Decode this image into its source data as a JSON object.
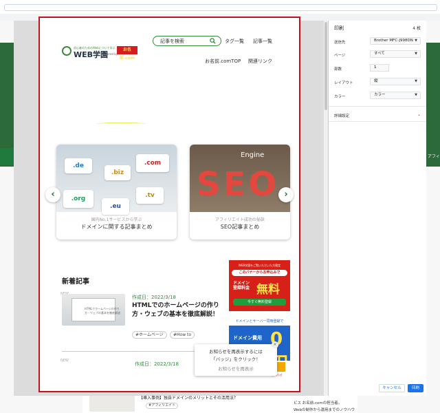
{
  "page": {
    "header": {
      "logo_text": "WEB学園",
      "logo_small": "初心者のためのWebについて学ぶ",
      "logo_powered": "Powered by",
      "logo_badge": "お名前.com"
    },
    "search_placeholder": "記事を検索",
    "nav": [
      "タグ一覧",
      "記事一覧",
      "お名前.comTOP",
      "関連リンク"
    ],
    "carousel": [
      {
        "sub": "国内No.1サービスから学ぶ",
        "title": "ドメインに関する記事まとめ",
        "bubbles": [
          ".de",
          ".biz",
          ".com",
          ".org",
          ".eu",
          ".tv"
        ]
      },
      {
        "sub": "アフィリエイト成功の秘訣",
        "title": "SEO記事まとめ",
        "image_text": "SEO",
        "image_word": "Engine"
      }
    ],
    "carousel_prev": "‹",
    "carousel_next": "›",
    "section_title": "新着記事",
    "articles": [
      {
        "badge": "NEW",
        "date": "作成日：2022/3/18",
        "title": "HTMLでのホームページの作り方・ウェブの基本を徹底解説！",
        "thumb_text": "HTMLでホームページの作り方・ウェブの基本を徹底解説",
        "tags": [
          "#ホームページ",
          "#How to"
        ]
      },
      {
        "badge": "NEW",
        "date": "作成日：2022/3/18"
      }
    ],
    "ad1": {
      "top": "WEB学園をご覧いただいた方限定",
      "band": "このバナーからお申込みで",
      "line1": "ドメイン",
      "line2": "登録料金",
      "big": "無料",
      "button": "今すぐ無料登録"
    },
    "ad2": {
      "top": "ドメインとサーバー同時登録で",
      "line1": "ドメイン費用",
      "big": "0円",
      "bottom": "お知らせ"
    },
    "popup": {
      "line1": "お知らせを再表示するには",
      "line2": "「バッジ」をクリック！",
      "line3": "お知らせを再表示",
      "close": "×"
    }
  },
  "print_panel": {
    "title": "印刷",
    "count": "4 枚",
    "rows": [
      {
        "label": "送信先",
        "value": "Brother MFC-J998DN"
      },
      {
        "label": "ページ",
        "value": "すべて"
      },
      {
        "label": "部数",
        "value": "1"
      },
      {
        "label": "レイアウト",
        "value": "縦"
      },
      {
        "label": "カラー",
        "value": "カラー"
      }
    ],
    "more": "詳細設定",
    "cancel": "キャンセル",
    "print": "印刷"
  },
  "background": {
    "right_label": "アフィ",
    "footer_title": "【導入事例】独自ドメインのメリットとその活用法？",
    "footer_tag": "#アフィリエイト",
    "footer_right1": "ビス お名前.comの担当者。",
    "footer_right2": "Webの制作から運用までのノウハウ"
  },
  "colors": {
    "accent_green": "#2f8a3a",
    "frame_red": "#c0121d",
    "print_blue": "#1a73e8"
  }
}
